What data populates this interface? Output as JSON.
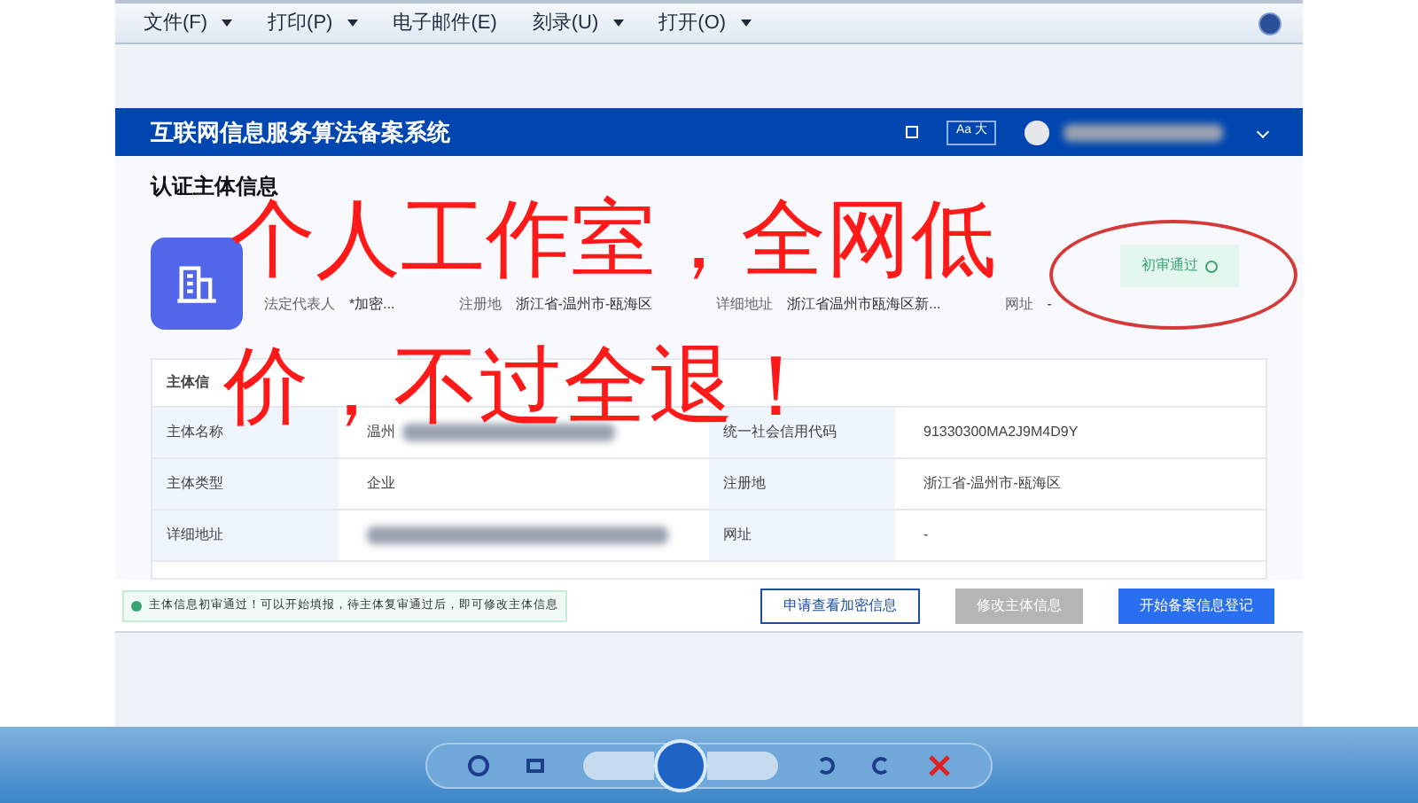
{
  "menu": [
    {
      "label": "文件(F)",
      "dropdown": true
    },
    {
      "label": "打印(P)",
      "dropdown": true
    },
    {
      "label": "电子邮件(E)",
      "dropdown": false
    },
    {
      "label": "刻录(U)",
      "dropdown": true
    },
    {
      "label": "打开(O)",
      "dropdown": true
    }
  ],
  "site": {
    "title": "互联网信息服务算法备案系统",
    "font_toggle": "Aa 大"
  },
  "section_title": "认证主体信息",
  "entity": {
    "fields": [
      {
        "label": "法定代表人",
        "value": "*加密..."
      },
      {
        "label": "注册地",
        "value": "浙江省-温州市-瓯海区"
      },
      {
        "label": "详细地址",
        "value": "浙江省温州市瓯海区新..."
      },
      {
        "label": "网址",
        "value": "-"
      }
    ],
    "status": "初审通过"
  },
  "table": {
    "title": "主体信",
    "rows": [
      [
        {
          "label": "主体名称",
          "value": "温州"
        },
        {
          "label": "统一社会信用代码",
          "value": "91330300MA2J9M4D9Y"
        }
      ],
      [
        {
          "label": "主体类型",
          "value": "企业"
        },
        {
          "label": "注册地",
          "value": "浙江省-温州市-瓯海区"
        }
      ],
      [
        {
          "label": "详细地址"
        },
        {
          "label": "网址",
          "value": "-"
        }
      ]
    ]
  },
  "notice": "主体信息初审通过！可以开始填报，待主体复审通过后，即可修改主体信息",
  "buttons": [
    {
      "label": "申请查看加密信息",
      "kind": "outline",
      "disabled": false
    },
    {
      "label": "修改主体信息",
      "kind": "primary",
      "disabled": true
    },
    {
      "label": "开始备案信息登记",
      "kind": "primary",
      "disabled": false
    }
  ],
  "overlay": [
    "个人工作室，全网低",
    "价，不过全退！"
  ]
}
